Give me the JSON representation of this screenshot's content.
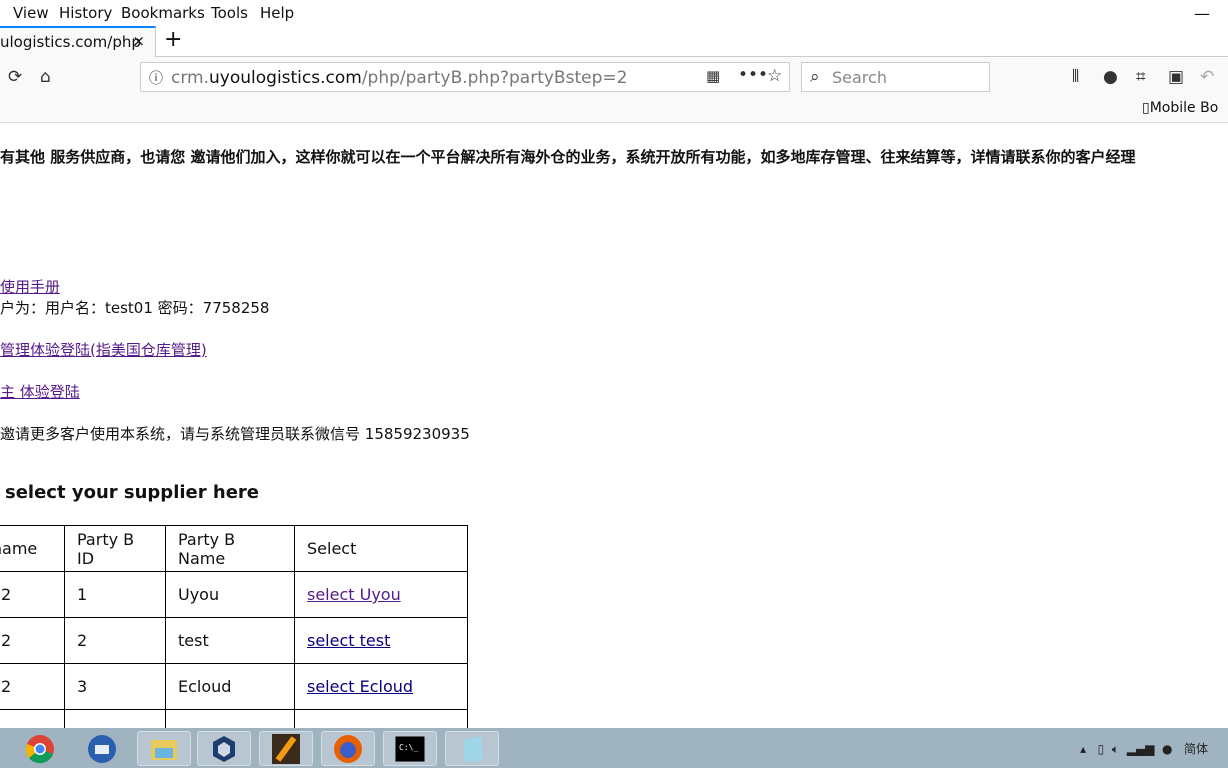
{
  "menu": [
    "View",
    "History",
    "Bookmarks",
    "Tools",
    "Help"
  ],
  "tab": {
    "title": "ulogistics.com/php",
    "close": "×",
    "new": "+"
  },
  "url": {
    "pre": "crm.",
    "host": "uyoulogistics.com",
    "path": "/php/partyB.php?partyBstep=2"
  },
  "search_placeholder": "Search",
  "mobile": "Mobile Bo",
  "notice": "有其他 服务供应商，也请您 邀请他们加入，这样你就可以在一个平台解决所有海外仓的业务，系统开放所有功能，如多地库存管理、往来结算等，详情请联系你的客户经理",
  "links": {
    "manual": "使用手册",
    "creds": "户为：用户名：test01 密码：7758258",
    "demo1": "管理体验登陆(指美国仓库管理)",
    "demo2": "主 体验登陆",
    "invite": "邀请更多客户使用本系统，请与系统管理员联系微信号 15859230935"
  },
  "heading": "select your supplier here",
  "table": {
    "headers": [
      "llname",
      "Party B ID",
      "Party B Name",
      "Select"
    ],
    "rows": [
      [
        "2",
        "1",
        "Uyou",
        "select Uyou"
      ],
      [
        "2",
        "2",
        "test",
        "select test"
      ],
      [
        "2",
        "3",
        "Ecloud",
        "select Ecloud"
      ],
      [
        "",
        "",
        "",
        ""
      ]
    ]
  },
  "taskbar": [
    "chrome",
    "thunderbird",
    "file-explorer",
    "virtualbox",
    "xampp",
    "firefox",
    "cmd",
    "notepad"
  ],
  "tray": "简体"
}
